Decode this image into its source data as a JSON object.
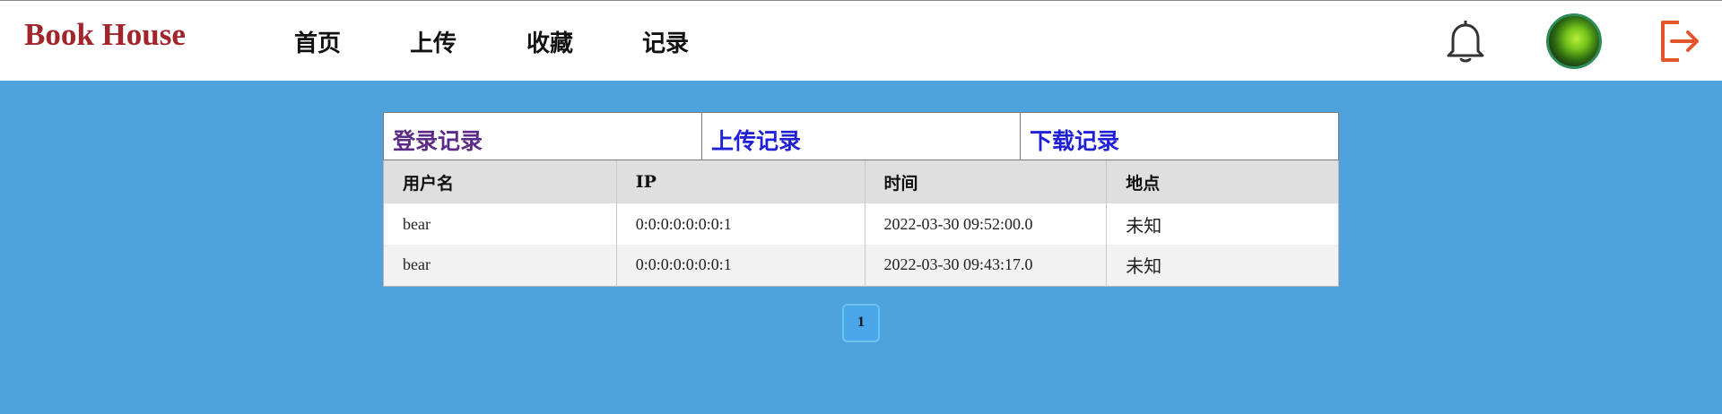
{
  "header": {
    "brand": "Book House",
    "nav": [
      {
        "label": "首页"
      },
      {
        "label": "上传"
      },
      {
        "label": "收藏"
      },
      {
        "label": "记录"
      }
    ],
    "icons": {
      "bell": "bell-icon",
      "avatar": "avatar",
      "logout": "logout-icon"
    },
    "colors": {
      "brand": "#a0262c",
      "logout": "#e2552d",
      "avatar_ring": "#2f8b57"
    }
  },
  "tabs": [
    {
      "label": "登录记录",
      "color": "#5b2b87"
    },
    {
      "label": "上传记录",
      "color": "#1f1fd6"
    },
    {
      "label": "下载记录",
      "color": "#1f1fd6"
    }
  ],
  "table": {
    "columns": [
      "用户名",
      "IP",
      "时间",
      "地点"
    ],
    "rows": [
      {
        "user": "bear",
        "ip": "0:0:0:0:0:0:0:1",
        "time": "2022-03-30 09:52:00.0",
        "location": "未知"
      },
      {
        "user": "bear",
        "ip": "0:0:0:0:0:0:0:1",
        "time": "2022-03-30 09:43:17.0",
        "location": "未知"
      }
    ]
  },
  "pagination": {
    "current": "1"
  },
  "colors": {
    "background": "#4fa3dc",
    "header_row": "#dfdfdf",
    "stripe": "#f2f2f2"
  }
}
